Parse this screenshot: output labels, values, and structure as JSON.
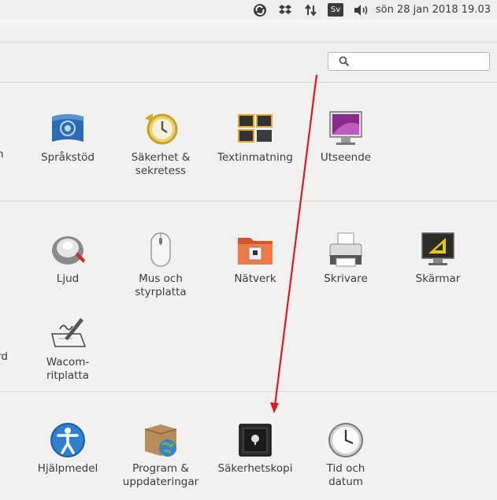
{
  "topbar": {
    "lang": "Sv",
    "clock": "sön 28 jan 2018 19.03",
    "indicators": [
      "sync-icon",
      "dropbox-icon",
      "network-icon",
      "keyboard-layout",
      "volume-icon"
    ]
  },
  "search": {
    "placeholder": "",
    "value": ""
  },
  "sections": [
    {
      "partial_label": "n",
      "items": [
        {
          "label": "Språkstöd",
          "icon": "language-support-icon"
        },
        {
          "label": "Säkerhet &\nsekretess",
          "icon": "security-privacy-icon"
        },
        {
          "label": "Textinmatning",
          "icon": "text-entry-icon"
        },
        {
          "label": "Utseende",
          "icon": "appearance-icon"
        }
      ]
    },
    {
      "partial_label": "rd",
      "items": [
        {
          "label": "Ljud",
          "icon": "sound-icon"
        },
        {
          "label": "Mus och\nstyrplatta",
          "icon": "mouse-touchpad-icon"
        },
        {
          "label": "Nätverk",
          "icon": "network-folder-icon"
        },
        {
          "label": "Skrivare",
          "icon": "printer-icon"
        },
        {
          "label": "Skärmar",
          "icon": "displays-icon"
        },
        {
          "label": "Wacom-\nritplatta",
          "icon": "wacom-tablet-icon"
        }
      ]
    },
    {
      "items": [
        {
          "label": "Hjälpmedel",
          "icon": "accessibility-icon"
        },
        {
          "label": "Program &\nuppdateringar",
          "icon": "software-updates-icon"
        },
        {
          "label": "Säkerhetskopi",
          "icon": "backup-icon"
        },
        {
          "label": "Tid och\ndatum",
          "icon": "time-date-icon"
        }
      ]
    }
  ],
  "colors": {
    "annotation_arrow": "#e0191d",
    "background": "#f2f1ef"
  }
}
